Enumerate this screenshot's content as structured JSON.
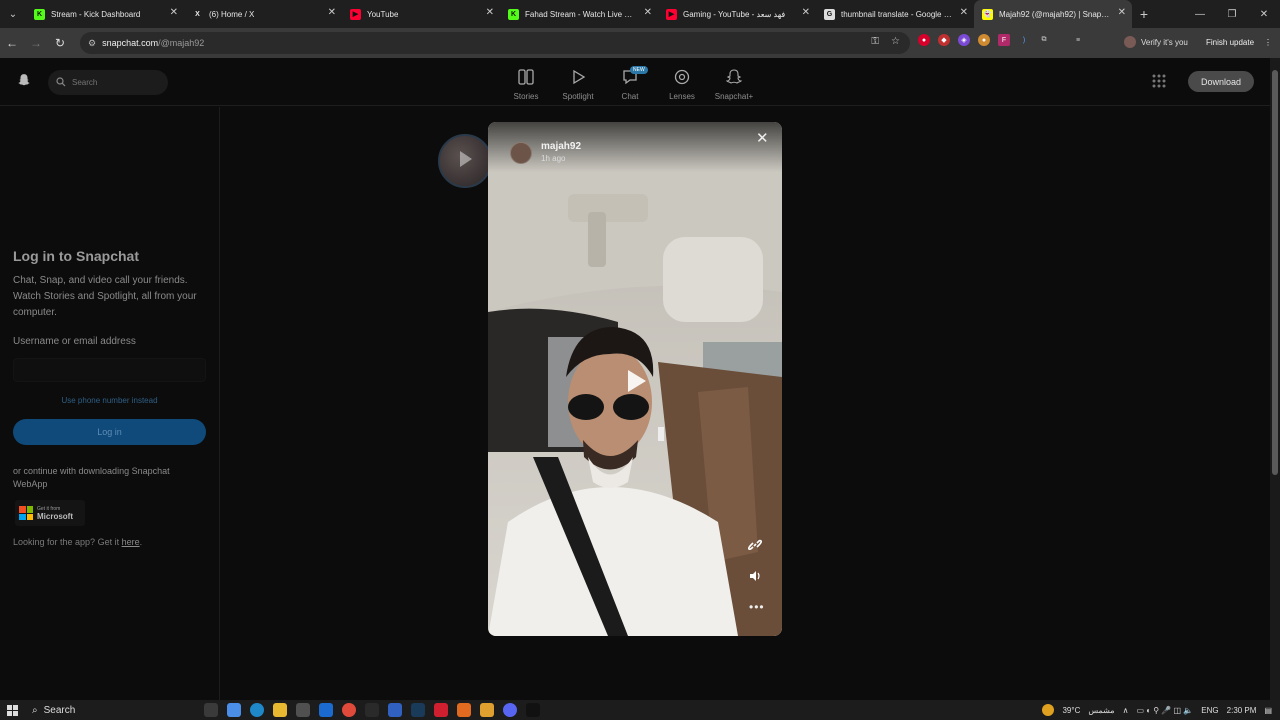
{
  "browser": {
    "tabs": [
      {
        "title": "Stream - Kick Dashboard",
        "icon": "kick-icon",
        "color": "#53fc18",
        "letter": "K"
      },
      {
        "title": "(6) Home / X",
        "icon": "x-icon",
        "color": "#1f1f1f",
        "letter": "X"
      },
      {
        "title": "YouTube",
        "icon": "youtube-icon",
        "color": "#ff0033",
        "letter": "▶"
      },
      {
        "title": "Fahad Stream - Watch Live on K",
        "icon": "kick-icon",
        "color": "#53fc18",
        "letter": "K"
      },
      {
        "title": "Gaming - YouTube - فهد سعد",
        "icon": "youtube-icon",
        "color": "#ff0033",
        "letter": "▶"
      },
      {
        "title": "thumbnail translate - Google Se",
        "icon": "google-icon",
        "color": "#dddddd",
        "letter": "G"
      },
      {
        "title": "Majah92 (@majah92) | Snapcha",
        "icon": "snapchat-icon",
        "color": "#fffc00",
        "letter": "👻"
      }
    ],
    "active_tab": 6,
    "url_host": "snapchat.com",
    "url_path": "/@majah92",
    "verify_label": "Verify it's you",
    "finish_update_label": "Finish update"
  },
  "header": {
    "search_placeholder": "Search",
    "nav": [
      {
        "label": "Stories",
        "icon": "stories-icon"
      },
      {
        "label": "Spotlight",
        "icon": "spotlight-icon"
      },
      {
        "label": "Chat",
        "icon": "chat-icon",
        "badge": "NEW"
      },
      {
        "label": "Lenses",
        "icon": "lenses-icon"
      },
      {
        "label": "Snapchat+",
        "icon": "snapchat-plus-icon"
      }
    ],
    "download_label": "Download"
  },
  "sidebar": {
    "title": "Log in to Snapchat",
    "description": "Chat, Snap, and video call your friends. Watch Stories and Spotlight, all from your computer.",
    "username_label": "Username or email address",
    "phone_link": "Use phone number instead",
    "login_label": "Log in",
    "continue_text": "or continue with downloading Snapchat WebApp",
    "ms_small": "Get it from",
    "ms_big": "Microsoft",
    "app_text": "Looking for the app? Get it ",
    "app_link": "here",
    "app_text_end": "."
  },
  "story": {
    "username": "majah92",
    "time_ago": "1h ago"
  },
  "taskbar": {
    "search_label": "Search",
    "weather": "39°C",
    "weather_desc": "مشمس",
    "language": "ENG",
    "time": "2:30 PM"
  }
}
